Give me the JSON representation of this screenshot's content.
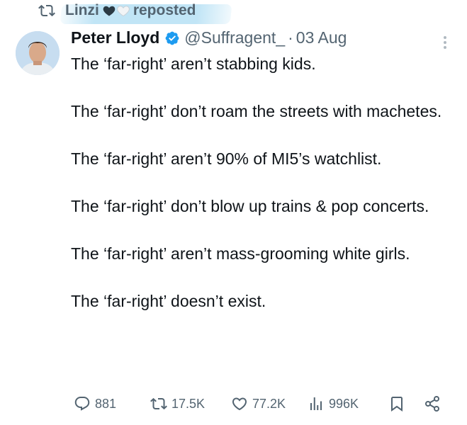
{
  "repost": {
    "icon": "repost-icon",
    "user": "Linzi",
    "label": "reposted"
  },
  "tweet": {
    "author_name": "Peter Lloyd",
    "handle": "@Suffragent_",
    "separator": "·",
    "date": "03 Aug",
    "verified_color": "#1d9bf0",
    "paragraphs": [
      "The ‘far-right’ aren’t stabbing kids.",
      "The ‘far-right’ don’t roam the streets with machetes.",
      "The ‘far-right’ aren’t 90% of MI5’s watchlist.",
      "The ‘far-right’ don’t blow up trains & pop concerts.",
      "The ‘far-right’ aren’t mass-grooming white girls.",
      "The ‘far-right’ doesn’t exist."
    ]
  },
  "actions": {
    "replies": "881",
    "reposts": "17.5K",
    "likes": "77.2K",
    "views": "996K"
  }
}
